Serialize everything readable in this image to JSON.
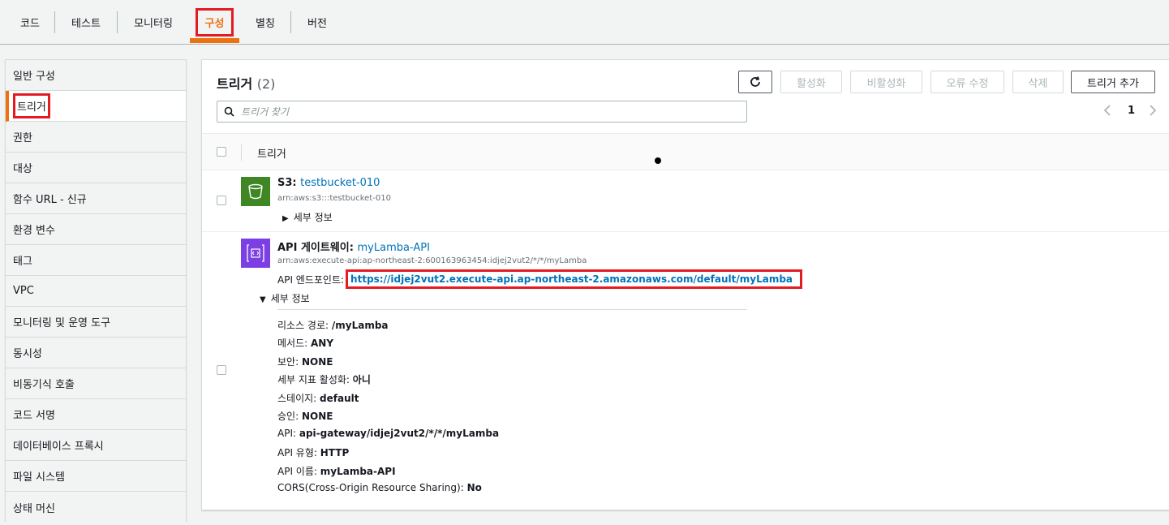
{
  "tabs": [
    {
      "label": "코드"
    },
    {
      "label": "테스트"
    },
    {
      "label": "모니터링"
    },
    {
      "label": "구성"
    },
    {
      "label": "별칭"
    },
    {
      "label": "버전"
    }
  ],
  "sidebar": {
    "items": [
      {
        "label": "일반 구성"
      },
      {
        "label": "트리거"
      },
      {
        "label": "권한"
      },
      {
        "label": "대상"
      },
      {
        "label": "함수 URL - 신규"
      },
      {
        "label": "환경 변수"
      },
      {
        "label": "태그"
      },
      {
        "label": "VPC"
      },
      {
        "label": "모니터링 및 운영 도구"
      },
      {
        "label": "동시성"
      },
      {
        "label": "비동기식 호출"
      },
      {
        "label": "코드 서명"
      },
      {
        "label": "데이터베이스 프록시"
      },
      {
        "label": "파일 시스템"
      },
      {
        "label": "상태 머신"
      }
    ]
  },
  "panel": {
    "title": "트리거",
    "count": "(2)",
    "buttons": {
      "refresh": "refresh-icon",
      "enable": "활성화",
      "disable": "비활성화",
      "fix_errors": "오류 수정",
      "delete": "삭제",
      "add_trigger": "트리거 추가"
    },
    "search_placeholder": "트리거 찾기",
    "page": "1",
    "column_header": "트리거"
  },
  "triggers": [
    {
      "service": "S3",
      "name": "testbucket-010",
      "arn": "arn:aws:s3:::testbucket-010",
      "details_label": "세부 정보"
    },
    {
      "service": "API 게이트웨이",
      "name": "myLamba-API",
      "arn": "arn:aws:execute-api:ap-northeast-2:600163963454:idjej2vut2/*/*/myLamba",
      "endpoint_label": "API 엔드포인트:",
      "endpoint_url": "https://idjej2vut2.execute-api.ap-northeast-2.amazonaws.com/default/myLamba",
      "details_label": "세부 정보",
      "details": [
        {
          "key": "리소스 경로: ",
          "value": "/myLamba"
        },
        {
          "key": "메서드: ",
          "value": "ANY"
        },
        {
          "key": "보안: ",
          "value": "NONE"
        },
        {
          "key": "세부 지표 활성화: ",
          "value": "아니"
        },
        {
          "key": "스테이지: ",
          "value": "default"
        },
        {
          "key": "승인: ",
          "value": "NONE"
        },
        {
          "key": "API: ",
          "value": "api-gateway/idjej2vut2/*/*/myLamba"
        },
        {
          "key": "API 유형: ",
          "value": "HTTP"
        },
        {
          "key": "API 이름: ",
          "value": "myLamba-API"
        },
        {
          "key": "CORS(Cross-Origin Resource Sharing): ",
          "value": "No"
        }
      ]
    }
  ],
  "colors": {
    "accent": "#ec7211",
    "link": "#0073bb",
    "highlight": "#e41b23",
    "s3": "#3f8624",
    "apigw": "#7b3fe4"
  }
}
